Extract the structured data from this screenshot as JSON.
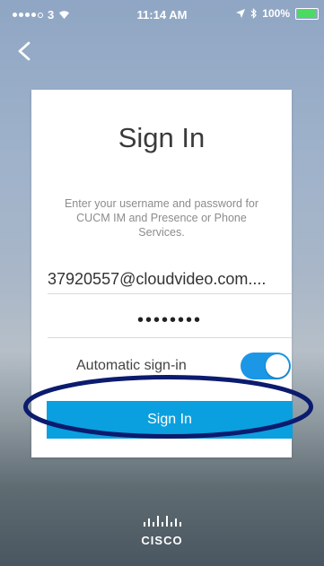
{
  "status_bar": {
    "carrier": "3",
    "time": "11:14 AM",
    "battery_percent": "100%",
    "battery_level": 1.0,
    "battery_color": "#4cd964"
  },
  "navigation": {
    "back_icon": "chevron-left-icon"
  },
  "signin_card": {
    "title": "Sign In",
    "instructions": "Enter your username and password for CUCM IM and Presence or Phone Services.",
    "username_value": "37920557@cloudvideo.com....",
    "password_masked": "••••••••",
    "auto_signin_label": "Automatic sign-in",
    "auto_signin_enabled": true,
    "signin_button_label": "Sign In",
    "accent_color": "#0aa0df",
    "toggle_color": "#1b97e6",
    "highlight_color": "#0b1b6e"
  },
  "branding": {
    "logo_text": "CISCO",
    "logo_icon": "cisco-bridge-icon"
  }
}
